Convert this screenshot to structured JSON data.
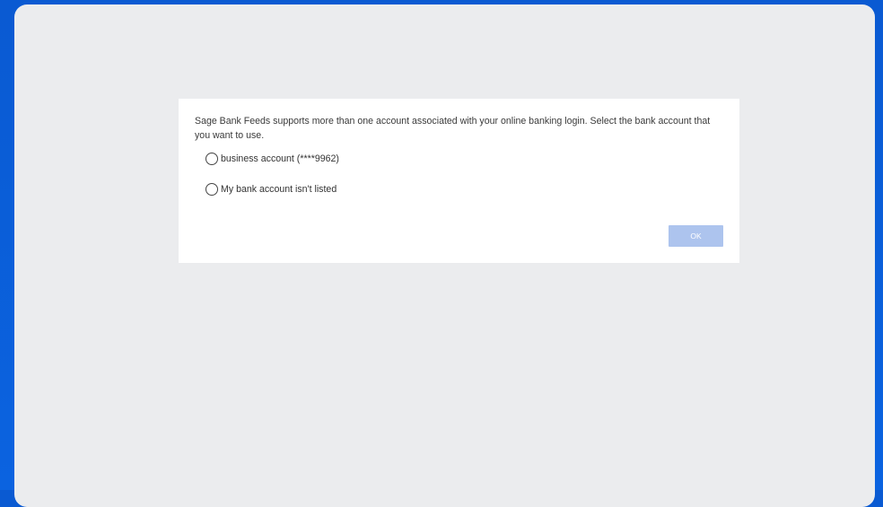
{
  "dialog": {
    "message": "Sage Bank Feeds supports more than one account associated with your online banking login. Select the bank account that you want to use.",
    "options": [
      {
        "label": "business account (****9962)",
        "selected": false
      },
      {
        "label": "My bank account isn't listed",
        "selected": false
      }
    ],
    "ok_label": "OK",
    "ok_enabled": false
  },
  "colors": {
    "background_blue": "#0a5fd6",
    "panel_gray": "#ebecee",
    "ok_button_disabled": "#adc4ee"
  }
}
